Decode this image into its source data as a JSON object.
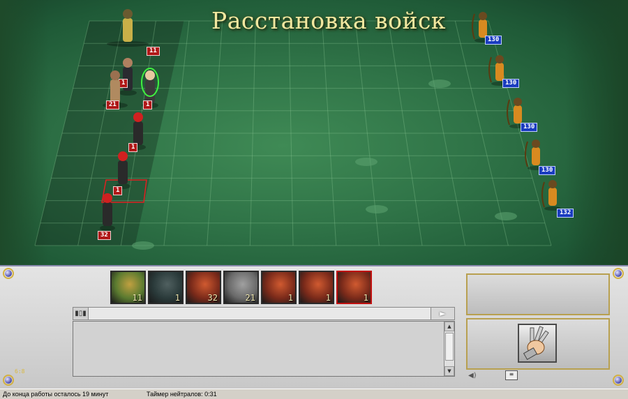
{
  "title": "Расстановка войск",
  "left_army": [
    {
      "name": "lizard-rider",
      "count": "11"
    },
    {
      "name": "agent",
      "count": "1"
    },
    {
      "name": "ogre",
      "count": "21"
    },
    {
      "name": "elf-scout-selected",
      "count": "1"
    },
    {
      "name": "red-haired-warrior-1",
      "count": "1"
    },
    {
      "name": "red-haired-warrior-2",
      "count": "1"
    },
    {
      "name": "red-haired-warrior-3",
      "count": "32"
    }
  ],
  "right_army": [
    {
      "name": "archer",
      "count": "130"
    },
    {
      "name": "archer",
      "count": "130"
    },
    {
      "name": "archer",
      "count": "130"
    },
    {
      "name": "archer",
      "count": "130"
    },
    {
      "name": "archer",
      "count": "132"
    }
  ],
  "queue": [
    {
      "portrait": "lizard",
      "count": "11",
      "active": false
    },
    {
      "portrait": "hooded",
      "count": "1",
      "active": false
    },
    {
      "portrait": "redhair",
      "count": "32",
      "active": false
    },
    {
      "portrait": "ogre",
      "count": "21",
      "active": false
    },
    {
      "portrait": "redhair",
      "count": "1",
      "active": false
    },
    {
      "portrait": "redhair",
      "count": "1",
      "active": false
    },
    {
      "portrait": "redhair",
      "count": "1",
      "active": true
    }
  ],
  "coords": "6:8",
  "status": {
    "left": "До конца работы осталось 19 минут",
    "timer": "Таймер нейтралов: 0:31"
  },
  "icons": {
    "attack": "gauntlet-fist-icon",
    "sound": "speaker-icon",
    "chat": "chat-icon",
    "send": "send-arrow-icon"
  },
  "colors": {
    "own_badge": "#b01818",
    "enemy_badge": "#1a3cc0",
    "title": "#f2e8a0"
  }
}
